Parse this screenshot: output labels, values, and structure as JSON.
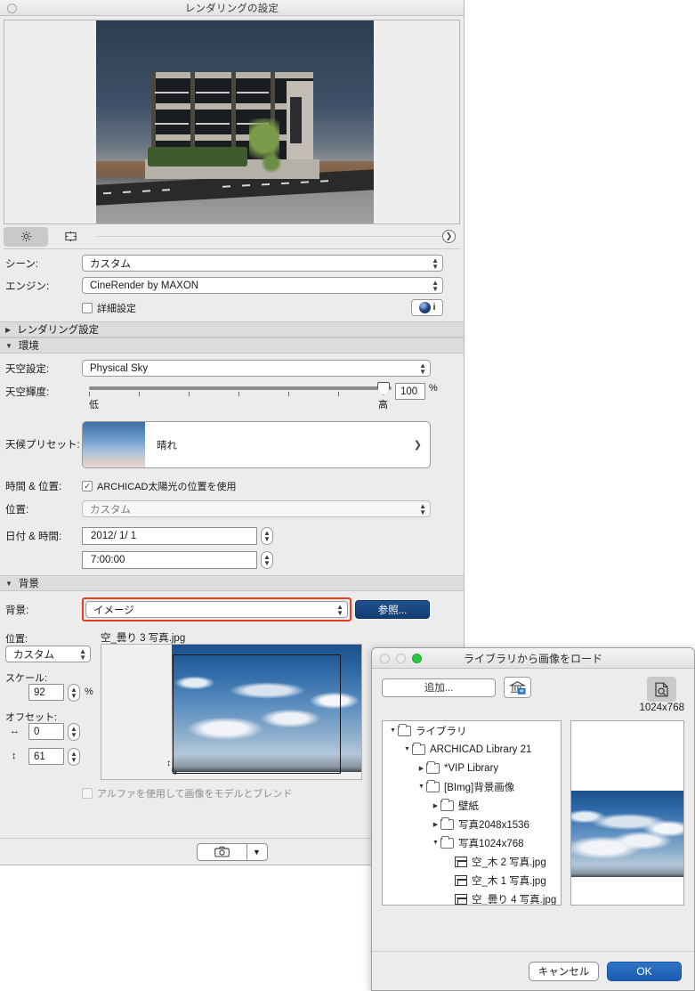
{
  "render_window": {
    "title": "レンダリングの設定",
    "close_button_icon": "close-circle-icon",
    "tabs": [
      {
        "id": "settings",
        "icon": "gear-icon",
        "active": true
      },
      {
        "id": "size",
        "icon": "frame-icon",
        "active": false
      }
    ],
    "expand_arrow_icon": "chevron-right-icon",
    "fields": {
      "scene_label": "シーン:",
      "scene_value": "カスタム",
      "engine_label": "エンジン:",
      "engine_value": "CineRender by MAXON",
      "detail_checkbox_label": "詳細設定",
      "detail_checkbox_checked": false,
      "info_button_label": "i",
      "info_button_icon": "maxon-orb-icon"
    },
    "sections": {
      "render_settings": {
        "label": "レンダリング設定",
        "expanded": false
      },
      "environment": {
        "label": "環境",
        "expanded": true
      },
      "background": {
        "label": "背景",
        "expanded": true
      }
    },
    "environment": {
      "sky_label": "天空設定:",
      "sky_value": "Physical Sky",
      "brightness_label": "天空輝度:",
      "brightness_value": "100",
      "brightness_unit": "%",
      "brightness_low": "低",
      "brightness_high": "高",
      "weather_label": "天候プリセット:",
      "weather_value": "晴れ",
      "weather_chevron_icon": "chevron-right-icon",
      "time_position_label": "時間 & 位置:",
      "sun_checkbox_label": "ARCHICAD太陽光の位置を使用",
      "sun_checkbox_checked": true,
      "position_label": "位置:",
      "position_value": "カスタム",
      "datetime_label": "日付 & 時間:",
      "date_value": "2012/  1/  1",
      "time_value": "7:00:00"
    },
    "background": {
      "background_label": "背景:",
      "background_value": "イメージ",
      "browse_button": "参照...",
      "highlight_color": "#e8401f",
      "position_label": "位置:",
      "position_value": "カスタム",
      "scale_label": "スケール:",
      "scale_value": "92",
      "scale_unit": "%",
      "offset_label": "オフセット:",
      "offset_x_icon": "horizontal-arrows-icon",
      "offset_x_value": "0",
      "offset_y_icon": "vertical-arrows-icon",
      "offset_y_value": "61",
      "alpha_checkbox_label": "アルファを使用して画像をモデルとブレンド",
      "alpha_checkbox_checked": false,
      "alpha_checkbox_disabled": true,
      "image_filename": "空_曇り 3 写真.jpg"
    },
    "footer": {
      "camera_button_icon": "camera-icon",
      "camera_dropdown_icon": "chevron-down-icon"
    }
  },
  "load_dialog": {
    "title": "ライブラリから画像をロード",
    "traffic_lights": [
      "close",
      "minimize",
      "zoom"
    ],
    "add_button": "追加...",
    "library_button_icon": "library-bank-icon",
    "preview_toggle_icon": "document-magnify-icon",
    "resolution_label": "1024x768",
    "tree": [
      {
        "label": "ライブラリ",
        "depth": 0,
        "type": "folder",
        "expanded": true,
        "selected": false
      },
      {
        "label": "ARCHICAD Library 21",
        "depth": 1,
        "type": "folder",
        "expanded": true,
        "selected": false
      },
      {
        "label": "*VIP Library",
        "depth": 2,
        "type": "folder",
        "expanded": false,
        "selected": false
      },
      {
        "label": "[BImg]背景画像",
        "depth": 2,
        "type": "folder",
        "expanded": true,
        "selected": false
      },
      {
        "label": "壁紙",
        "depth": 3,
        "type": "folder",
        "expanded": false,
        "selected": false
      },
      {
        "label": "写真2048x1536",
        "depth": 3,
        "type": "folder",
        "expanded": false,
        "selected": false
      },
      {
        "label": "写真1024x768",
        "depth": 3,
        "type": "folder",
        "expanded": true,
        "selected": false
      },
      {
        "label": "空_木 2 写真.jpg",
        "depth": 4,
        "type": "file",
        "expanded": null,
        "selected": false
      },
      {
        "label": "空_木 1 写真.jpg",
        "depth": 4,
        "type": "file",
        "expanded": null,
        "selected": false
      },
      {
        "label": "空_曇り 4 写真.jpg",
        "depth": 4,
        "type": "file",
        "expanded": null,
        "selected": false
      },
      {
        "label": "空_曇り 3 写真.jpg",
        "depth": 4,
        "type": "file",
        "expanded": null,
        "selected": true
      },
      {
        "label": "",
        "depth": 4,
        "type": "file",
        "expanded": null,
        "selected": false
      }
    ],
    "buttons": {
      "cancel": "キャンセル",
      "ok": "OK"
    }
  }
}
